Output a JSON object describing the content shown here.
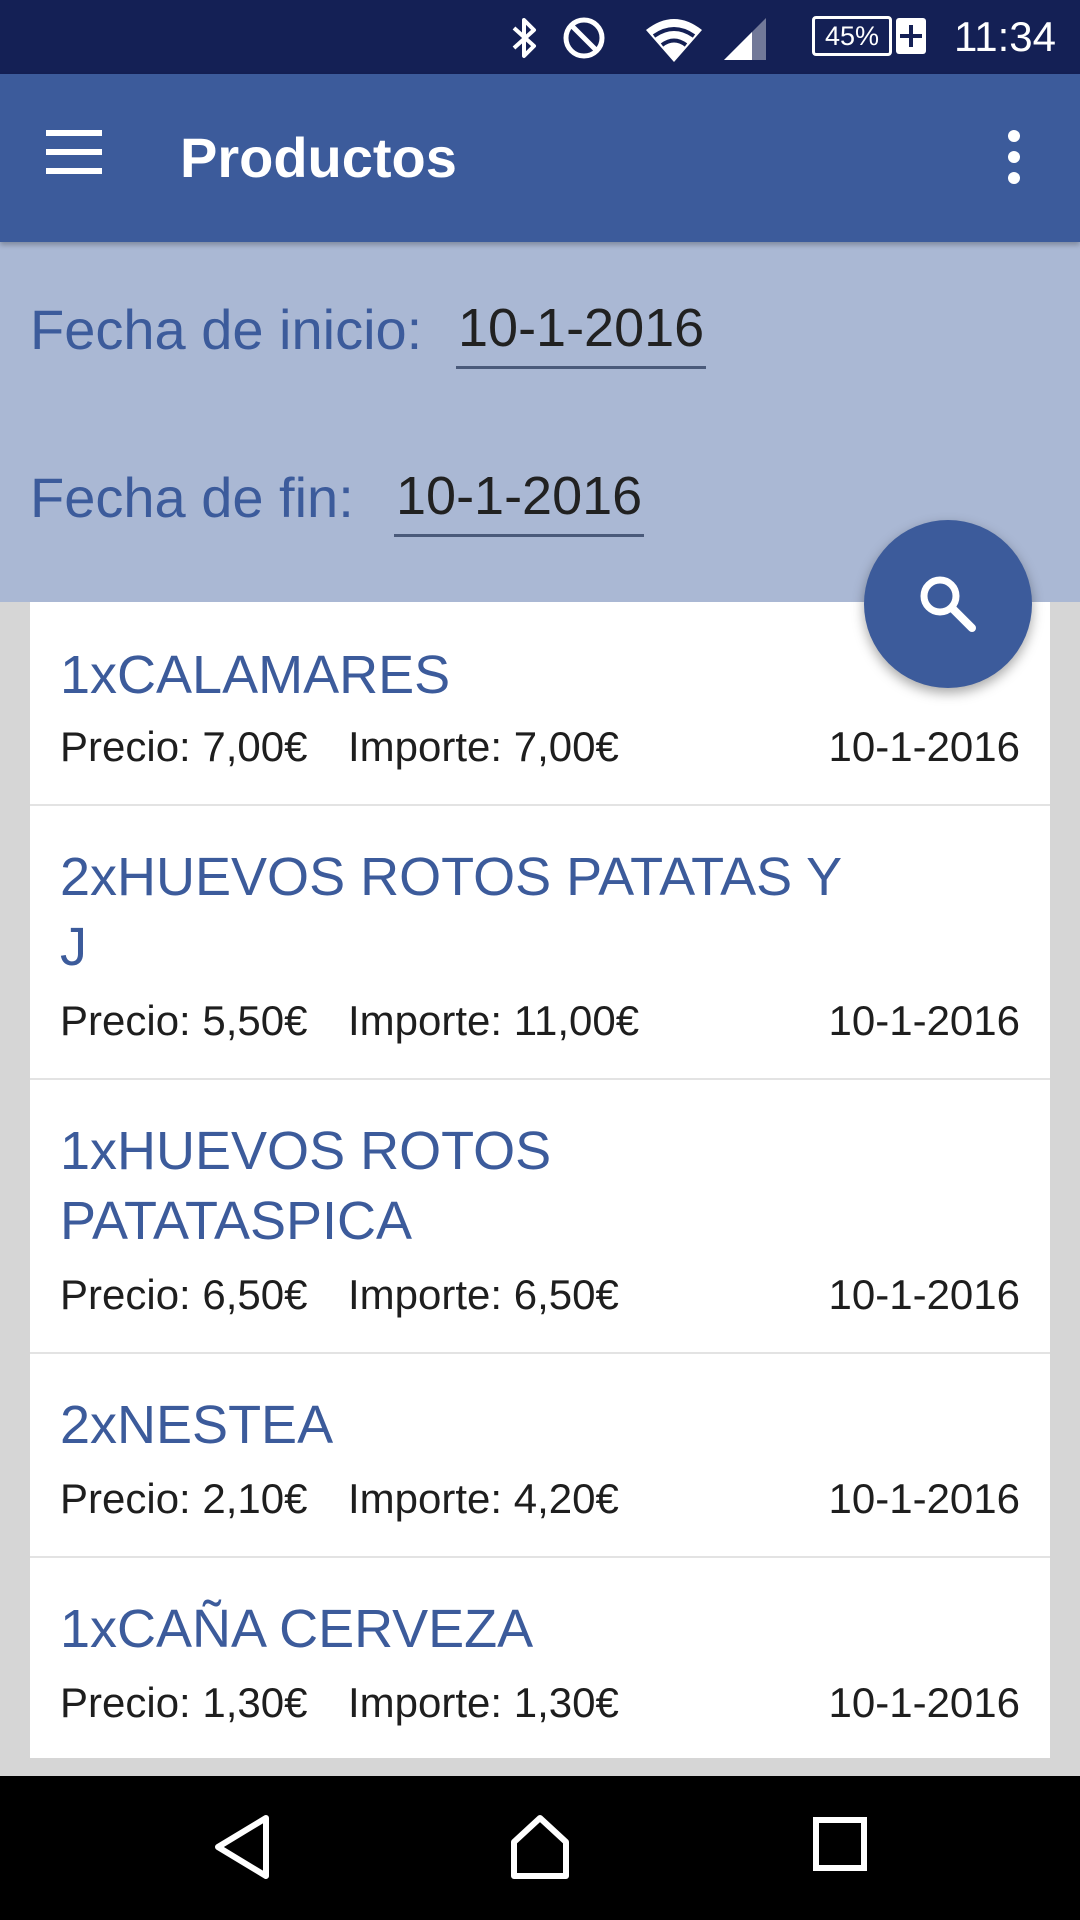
{
  "status_bar": {
    "time": "11:34",
    "battery": "45%",
    "icons": [
      "bluetooth-icon",
      "do-not-disturb-icon",
      "wifi-icon",
      "signal-icon",
      "battery-charging-icon"
    ]
  },
  "app_bar": {
    "title": "Productos",
    "menu_icon": "hamburger-menu-icon",
    "overflow_icon": "more-vert-icon"
  },
  "filter": {
    "start_label": "Fecha de inicio:",
    "start_value": "10-1-2016",
    "end_label": "Fecha de fin:",
    "end_value": "10-1-2016",
    "search_icon": "search-icon"
  },
  "products": [
    {
      "name": "1xCALAMARES",
      "price": "Precio: 7,00€",
      "amount": "Importe: 7,00€",
      "date": "10-1-2016"
    },
    {
      "name": "2xHUEVOS ROTOS PATATAS Y J",
      "price": "Precio: 5,50€",
      "amount": "Importe: 11,00€",
      "date": "10-1-2016"
    },
    {
      "name": "1xHUEVOS ROTOS PATATASPICA",
      "price": "Precio: 6,50€",
      "amount": "Importe: 6,50€",
      "date": "10-1-2016"
    },
    {
      "name": "2xNESTEA",
      "price": "Precio: 2,10€",
      "amount": "Importe: 4,20€",
      "date": "10-1-2016"
    },
    {
      "name": "1xCAÑA CERVEZA",
      "price": "Precio: 1,30€",
      "amount": "Importe: 1,30€",
      "date": "10-1-2016"
    }
  ],
  "nav_bar": {
    "back_icon": "back-icon",
    "home_icon": "home-icon",
    "recents_icon": "recents-icon"
  },
  "colors": {
    "primary": "#3c5b9b",
    "status_bar": "#142055",
    "filter_background": "#aab8d4"
  }
}
